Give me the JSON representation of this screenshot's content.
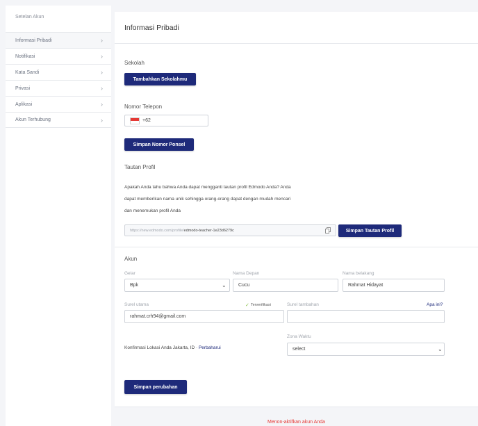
{
  "sidebar": {
    "header": "Setelan Akun",
    "items": [
      {
        "label": "Informasi Pribadi"
      },
      {
        "label": "Notifikasi"
      },
      {
        "label": "Kata Sandi"
      },
      {
        "label": "Privasi"
      },
      {
        "label": "Aplikasi"
      },
      {
        "label": "Akun Terhubung"
      }
    ]
  },
  "main": {
    "title": "Informasi Pribadi",
    "school": {
      "label": "Sekolah",
      "add_button": "Tambahkan Sekolahmu"
    },
    "phone": {
      "label": "Nomor Telepon",
      "value": "+62",
      "save_button": "Simpan Nomor Ponsel"
    },
    "profile_link": {
      "label": "Tautan Profil",
      "description_lines": [
        "Apakah Anda tahu bahwa Anda dapat mengganti tautan profil Edmodo Anda? Anda",
        "dapat memberikan nama unik sehingga orang-orang dapat dengan mudah mencari",
        "dan menemukan profil Anda"
      ],
      "url_prefix": "https://new.edmodo.com/profile/",
      "url_slug": "edmodo-teacher-1e23d6279c",
      "save_button": "Simpan Tautan Profil"
    },
    "account": {
      "label": "Akun",
      "title_label": "Gelar",
      "title_value": "Bpk",
      "first_name_label": "Nama Depan",
      "first_name_value": "Cucu",
      "last_name_label": "Nama belakang",
      "last_name_value": "Rahmat Hidayat",
      "email_label": "Surel utama",
      "email_value": "rahmat.crh94@gmail.com",
      "verified_text": "Terverifikasi",
      "extra_email_label": "Surel tambahan",
      "extra_email_value": "",
      "what_is_this": "Apa ini?",
      "location_text": "Konfirmasi Lokasi Anda Jakarta, ID ·",
      "update_link": "Perbaharui",
      "timezone_label": "Zona Waktu",
      "timezone_value": "select",
      "save_button": "Simpan perubahan"
    },
    "deactivate": "Menon-aktifkan akun Anda"
  },
  "colors": {
    "primary": "#1e2a7a",
    "danger": "#e53935",
    "verified": "#8bc34a"
  }
}
